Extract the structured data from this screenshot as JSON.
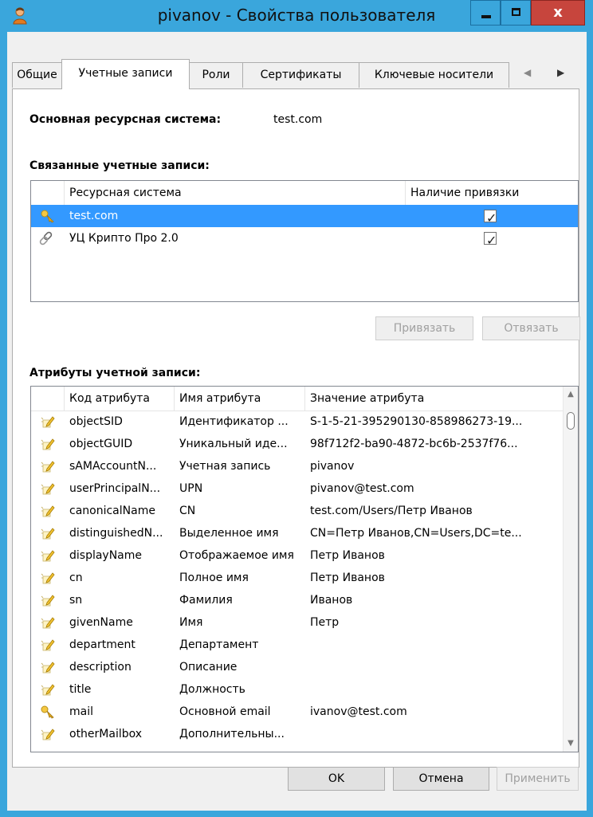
{
  "window": {
    "title": "pivanov - Свойства пользователя",
    "close_label": "x"
  },
  "tabs": [
    {
      "label": "Общие"
    },
    {
      "label": "Учетные записи"
    },
    {
      "label": "Роли"
    },
    {
      "label": "Сертификаты"
    },
    {
      "label": "Ключевые носители"
    }
  ],
  "tab_arrows": {
    "left": "◀",
    "right": "▶"
  },
  "main_system": {
    "label": "Основная ресурсная система:",
    "value": "test.com"
  },
  "linked": {
    "title": "Связанные учетные записи:",
    "columns": [
      "Ресурсная система",
      "Наличие привязки"
    ],
    "rows": [
      {
        "name": "test.com",
        "icon": "key-icon",
        "bound": true,
        "selected": true
      },
      {
        "name": "УЦ Крипто Про 2.0",
        "icon": "chain-link-icon",
        "bound": true,
        "selected": false
      }
    ],
    "bind_button": "Привязать",
    "unbind_button": "Отвязать"
  },
  "attributes": {
    "title": "Атрибуты учетной записи:",
    "columns": [
      "Код атрибута",
      "Имя атрибута",
      "Значение атрибута"
    ],
    "rows": [
      {
        "code": "objectSID",
        "name": "Идентификатор ...",
        "value": "S-1-5-21-395290130-858986273-19...",
        "icon": "pencil-note-icon"
      },
      {
        "code": "objectGUID",
        "name": "Уникальный иде...",
        "value": "98f712f2-ba90-4872-bc6b-2537f76...",
        "icon": "pencil-note-icon"
      },
      {
        "code": "sAMAccountN...",
        "name": "Учетная запись",
        "value": "pivanov",
        "icon": "pencil-note-icon"
      },
      {
        "code": "userPrincipalN...",
        "name": "UPN",
        "value": "pivanov@test.com",
        "icon": "pencil-note-icon"
      },
      {
        "code": "canonicalName",
        "name": "CN",
        "value": "test.com/Users/Петр Иванов",
        "icon": "pencil-note-icon"
      },
      {
        "code": "distinguishedN...",
        "name": "Выделенное имя",
        "value": "CN=Петр Иванов,CN=Users,DC=te...",
        "icon": "pencil-note-icon"
      },
      {
        "code": "displayName",
        "name": "Отображаемое имя",
        "value": "Петр Иванов",
        "icon": "pencil-note-icon"
      },
      {
        "code": "cn",
        "name": "Полное имя",
        "value": "Петр Иванов",
        "icon": "pencil-note-icon"
      },
      {
        "code": "sn",
        "name": "Фамилия",
        "value": "Иванов",
        "icon": "pencil-note-icon"
      },
      {
        "code": "givenName",
        "name": "Имя",
        "value": "Петр",
        "icon": "pencil-note-icon"
      },
      {
        "code": "department",
        "name": "Департамент",
        "value": "",
        "icon": "pencil-note-icon"
      },
      {
        "code": "description",
        "name": "Описание",
        "value": "",
        "icon": "pencil-note-icon"
      },
      {
        "code": "title",
        "name": "Должность",
        "value": "",
        "icon": "pencil-note-icon"
      },
      {
        "code": "mail",
        "name": "Основной email",
        "value": "ivanov@test.com",
        "icon": "key-icon"
      },
      {
        "code": "otherMailbox",
        "name": "Дополнительны...",
        "value": "",
        "icon": "pencil-note-icon"
      }
    ],
    "scroll_up": "▲",
    "scroll_down": "▼"
  },
  "footer": {
    "ok": "OK",
    "cancel": "Отмена",
    "apply": "Применить"
  },
  "colors": {
    "frame": "#3aa6dc",
    "selection": "#3399ff",
    "close_button": "#c7453d"
  }
}
